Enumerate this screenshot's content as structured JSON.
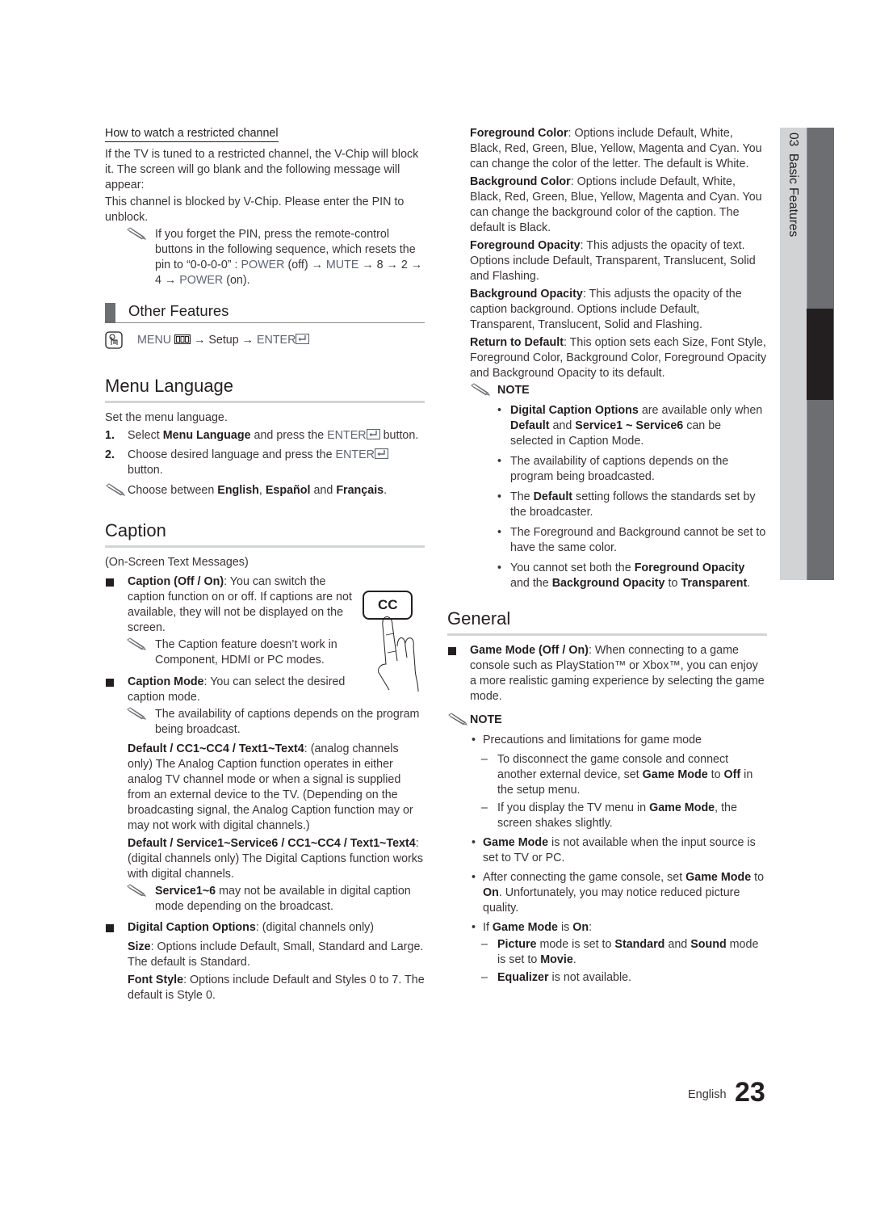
{
  "left": {
    "restricted": {
      "heading": "How to watch a restricted channel",
      "p1": "If the TV is tuned to a restricted channel, the V-Chip will block it. The screen will go blank and the following message will appear:",
      "p2": "This channel is blocked by V-Chip. Please enter the PIN to unblock.",
      "note": {
        "t1": "If you forget the PIN, press the remote-control buttons in the following sequence, which resets the pin to “0-0-0-0” : ",
        "k1": "POWER",
        "t2": " (off) → ",
        "k2": "MUTE",
        "t3": " → 8 → 2 → 4 → ",
        "k3": "POWER",
        "t4": " (on)."
      }
    },
    "other_features": {
      "title": "Other Features",
      "path": {
        "menu": "MENU",
        "arrow1": " → Setup → ",
        "enter": "ENTER"
      }
    },
    "menu_language": {
      "title": "Menu Language",
      "intro": "Set the menu language.",
      "steps": [
        {
          "n": "1.",
          "t1": "Select ",
          "b1": "Menu Language",
          "t2": " and press the ",
          "k": "ENTER",
          "t3": " button."
        },
        {
          "n": "2.",
          "t1": "Choose desired language and press the ",
          "k": "ENTER",
          "t3": " button."
        }
      ],
      "note": {
        "t1": "Choose between ",
        "b1": "English",
        "t2": ", ",
        "b2": "Español",
        "t3": " and ",
        "b3": "Français",
        "t4": "."
      }
    },
    "caption": {
      "title": "Caption",
      "intro": "(On-Screen Text Messages)",
      "cc_button_label": "CC",
      "item1": {
        "b": "Caption (Off / On)",
        "t": ": You can switch the caption function on or off. If captions are not available, they will not be displayed on the screen.",
        "note": "The Caption feature doesn’t work in Component, HDMI or PC modes."
      },
      "item2": {
        "b": "Caption Mode",
        "t": ": You can select the desired caption mode.",
        "note": "The availability of captions depends on the program being broadcast.",
        "analog_b": "Default / CC1~CC4 / Text1~Text4",
        "analog_t": ": (analog channels only) The Analog Caption function operates in either analog TV channel mode or when a signal is supplied from an external device to the TV. (Depending on the broadcasting signal, the Analog Caption function may or may not work with digital channels.)",
        "digital_b": "Default / Service1~Service6 / CC1~CC4 / Text1~Text4",
        "digital_t": ": (digital channels only) The Digital Captions function works with digital channels.",
        "note2_b": "Service1~6",
        "note2_t": " may not be available in digital caption mode depending on the broadcast."
      },
      "item3": {
        "b": "Digital Caption Options",
        "t": ": (digital channels only)",
        "size_b": "Size",
        "size_t": ": Options include Default, Small, Standard and Large. The default is Standard.",
        "font_b": "Font Style",
        "font_t": ": Options include Default and Styles 0 to 7. The default is Style 0."
      }
    }
  },
  "right": {
    "options": [
      {
        "b": "Foreground Color",
        "t": ": Options include Default, White, Black, Red, Green, Blue, Yellow, Magenta and Cyan. You can change the color of the letter. The default is White."
      },
      {
        "b": "Background Color",
        "t": ": Options include Default, White, Black, Red, Green, Blue, Yellow, Magenta and Cyan. You can change the background color of the caption. The default is Black."
      },
      {
        "b": "Foreground Opacity",
        "t": ": This adjusts the opacity of text. Options include Default, Transparent, Translucent, Solid and Flashing."
      },
      {
        "b": "Background Opacity",
        "t": ": This adjusts the opacity of the caption background. Options include Default, Transparent, Translucent, Solid and Flashing."
      },
      {
        "b": "Return to Default",
        "t": ": This option sets each Size, Font Style, Foreground Color, Background Color, Foreground Opacity and Background Opacity to its default."
      }
    ],
    "note_label": "NOTE",
    "caption_notes": {
      "n1": {
        "b1": "Digital Caption Options",
        "t1": " are available only when ",
        "b2": "Default",
        "t2": " and ",
        "b3": "Service1 ~ Service6",
        "t3": " can be selected in Caption Mode."
      },
      "n2": "The availability of captions depends on the program being broadcasted.",
      "n3": {
        "t1": "The ",
        "b1": "Default",
        "t2": " setting follows the standards set by the broadcaster."
      },
      "n4": "The Foreground and Background cannot be set to have the same color.",
      "n5": {
        "t1": "You cannot set both the ",
        "b1": "Foreground Opacity",
        "t2": " and the ",
        "b2": "Background Opacity",
        "t3": " to ",
        "b3": "Transparent",
        "t4": "."
      }
    },
    "general": {
      "title": "General",
      "game_b": "Game Mode (Off / On)",
      "game_t": ": When connecting to a game console such as PlayStation™ or Xbox™, you can enjoy a more realistic gaming experience by selecting the game mode.",
      "note_label": "NOTE",
      "b1": "Precautions and limitations for game mode",
      "d1": {
        "t1": "To disconnect the game console and connect another external device, set ",
        "b1": "Game Mode",
        "t2": " to ",
        "b2": "Off",
        "t3": " in the setup menu."
      },
      "d2": {
        "t1": "If you display the TV menu in ",
        "b1": "Game Mode",
        "t2": ", the screen shakes slightly."
      },
      "b2": {
        "b1": "Game Mode",
        "t1": " is not available when the input source is set to TV or PC."
      },
      "b3": {
        "t1": "After connecting the game console, set ",
        "b1": "Game Mode",
        "t2": " to ",
        "b2": "On",
        "t3": ". Unfortunately, you may notice reduced picture quality."
      },
      "b4": {
        "t1": "If ",
        "b1": "Game Mode",
        "t2": " is ",
        "b2": "On",
        "t3": ":"
      },
      "d3": {
        "b1": "Picture",
        "t1": " mode is set to ",
        "b2": "Standard",
        "t2": " and ",
        "b3": "Sound",
        "t3": " mode is set to ",
        "b4": "Movie",
        "t4": "."
      },
      "d4": {
        "b1": "Equalizer",
        "t1": " is not available."
      }
    }
  },
  "side_tab": {
    "label": "03  Basic Features"
  },
  "footer": {
    "language": "English",
    "page_number": "23"
  }
}
